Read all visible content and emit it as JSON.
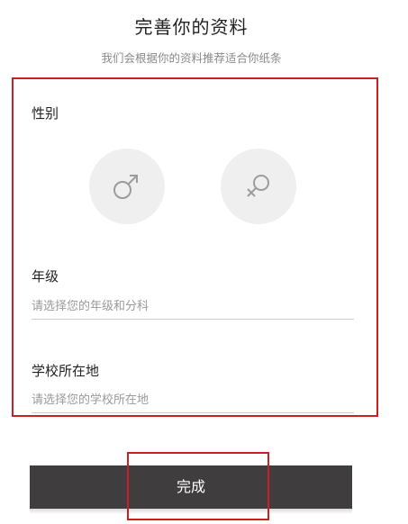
{
  "header": {
    "title": "完善你的资料",
    "subtitle": "我们会根据你的资料推荐适合你纸条"
  },
  "form": {
    "gender": {
      "label": "性别",
      "options": [
        {
          "value": "male",
          "icon": "male-symbol-icon"
        },
        {
          "value": "female",
          "icon": "female-symbol-icon"
        }
      ]
    },
    "grade": {
      "label": "年级",
      "placeholder": "请选择您的年级和分科",
      "value": ""
    },
    "school": {
      "label": "学校所在地",
      "placeholder": "请选择您的学校所在地",
      "value": ""
    }
  },
  "actions": {
    "submit_label": "完成"
  },
  "colors": {
    "highlight_border": "#cc1f24",
    "button_bg": "#3f3d3e",
    "gender_circle": "#efefef",
    "icon_stroke": "#9c9c9c"
  }
}
